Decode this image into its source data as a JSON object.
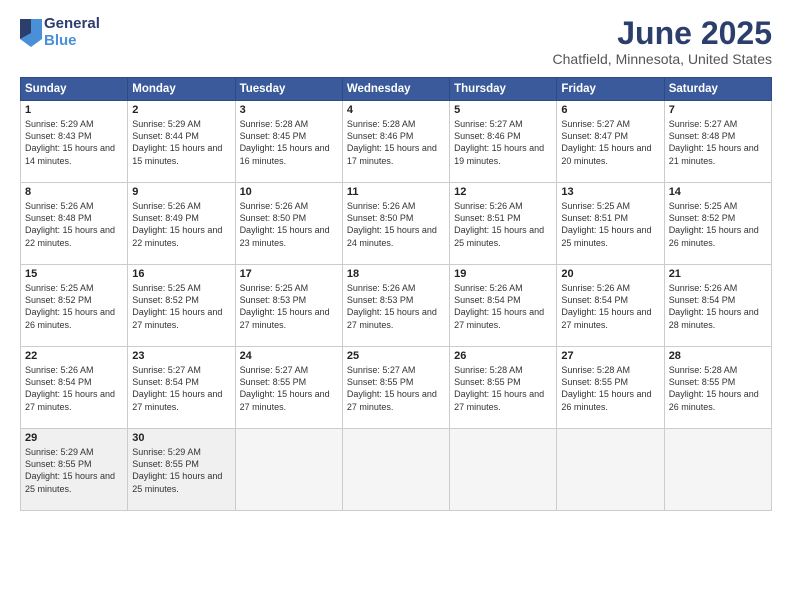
{
  "logo": {
    "general": "General",
    "blue": "Blue"
  },
  "title": "June 2025",
  "subtitle": "Chatfield, Minnesota, United States",
  "header_days": [
    "Sunday",
    "Monday",
    "Tuesday",
    "Wednesday",
    "Thursday",
    "Friday",
    "Saturday"
  ],
  "weeks": [
    [
      {
        "day": "1",
        "sunrise": "5:29 AM",
        "sunset": "8:43 PM",
        "daylight": "15 hours and 14 minutes."
      },
      {
        "day": "2",
        "sunrise": "5:29 AM",
        "sunset": "8:44 PM",
        "daylight": "15 hours and 15 minutes."
      },
      {
        "day": "3",
        "sunrise": "5:28 AM",
        "sunset": "8:45 PM",
        "daylight": "15 hours and 16 minutes."
      },
      {
        "day": "4",
        "sunrise": "5:28 AM",
        "sunset": "8:46 PM",
        "daylight": "15 hours and 17 minutes."
      },
      {
        "day": "5",
        "sunrise": "5:27 AM",
        "sunset": "8:46 PM",
        "daylight": "15 hours and 19 minutes."
      },
      {
        "day": "6",
        "sunrise": "5:27 AM",
        "sunset": "8:47 PM",
        "daylight": "15 hours and 20 minutes."
      },
      {
        "day": "7",
        "sunrise": "5:27 AM",
        "sunset": "8:48 PM",
        "daylight": "15 hours and 21 minutes."
      }
    ],
    [
      {
        "day": "8",
        "sunrise": "5:26 AM",
        "sunset": "8:48 PM",
        "daylight": "15 hours and 22 minutes."
      },
      {
        "day": "9",
        "sunrise": "5:26 AM",
        "sunset": "8:49 PM",
        "daylight": "15 hours and 22 minutes."
      },
      {
        "day": "10",
        "sunrise": "5:26 AM",
        "sunset": "8:50 PM",
        "daylight": "15 hours and 23 minutes."
      },
      {
        "day": "11",
        "sunrise": "5:26 AM",
        "sunset": "8:50 PM",
        "daylight": "15 hours and 24 minutes."
      },
      {
        "day": "12",
        "sunrise": "5:26 AM",
        "sunset": "8:51 PM",
        "daylight": "15 hours and 25 minutes."
      },
      {
        "day": "13",
        "sunrise": "5:25 AM",
        "sunset": "8:51 PM",
        "daylight": "15 hours and 25 minutes."
      },
      {
        "day": "14",
        "sunrise": "5:25 AM",
        "sunset": "8:52 PM",
        "daylight": "15 hours and 26 minutes."
      }
    ],
    [
      {
        "day": "15",
        "sunrise": "5:25 AM",
        "sunset": "8:52 PM",
        "daylight": "15 hours and 26 minutes."
      },
      {
        "day": "16",
        "sunrise": "5:25 AM",
        "sunset": "8:52 PM",
        "daylight": "15 hours and 27 minutes."
      },
      {
        "day": "17",
        "sunrise": "5:25 AM",
        "sunset": "8:53 PM",
        "daylight": "15 hours and 27 minutes."
      },
      {
        "day": "18",
        "sunrise": "5:26 AM",
        "sunset": "8:53 PM",
        "daylight": "15 hours and 27 minutes."
      },
      {
        "day": "19",
        "sunrise": "5:26 AM",
        "sunset": "8:54 PM",
        "daylight": "15 hours and 27 minutes."
      },
      {
        "day": "20",
        "sunrise": "5:26 AM",
        "sunset": "8:54 PM",
        "daylight": "15 hours and 27 minutes."
      },
      {
        "day": "21",
        "sunrise": "5:26 AM",
        "sunset": "8:54 PM",
        "daylight": "15 hours and 28 minutes."
      }
    ],
    [
      {
        "day": "22",
        "sunrise": "5:26 AM",
        "sunset": "8:54 PM",
        "daylight": "15 hours and 27 minutes."
      },
      {
        "day": "23",
        "sunrise": "5:27 AM",
        "sunset": "8:54 PM",
        "daylight": "15 hours and 27 minutes."
      },
      {
        "day": "24",
        "sunrise": "5:27 AM",
        "sunset": "8:55 PM",
        "daylight": "15 hours and 27 minutes."
      },
      {
        "day": "25",
        "sunrise": "5:27 AM",
        "sunset": "8:55 PM",
        "daylight": "15 hours and 27 minutes."
      },
      {
        "day": "26",
        "sunrise": "5:28 AM",
        "sunset": "8:55 PM",
        "daylight": "15 hours and 27 minutes."
      },
      {
        "day": "27",
        "sunrise": "5:28 AM",
        "sunset": "8:55 PM",
        "daylight": "15 hours and 26 minutes."
      },
      {
        "day": "28",
        "sunrise": "5:28 AM",
        "sunset": "8:55 PM",
        "daylight": "15 hours and 26 minutes."
      }
    ],
    [
      {
        "day": "29",
        "sunrise": "5:29 AM",
        "sunset": "8:55 PM",
        "daylight": "15 hours and 25 minutes."
      },
      {
        "day": "30",
        "sunrise": "5:29 AM",
        "sunset": "8:55 PM",
        "daylight": "15 hours and 25 minutes."
      },
      null,
      null,
      null,
      null,
      null
    ]
  ]
}
